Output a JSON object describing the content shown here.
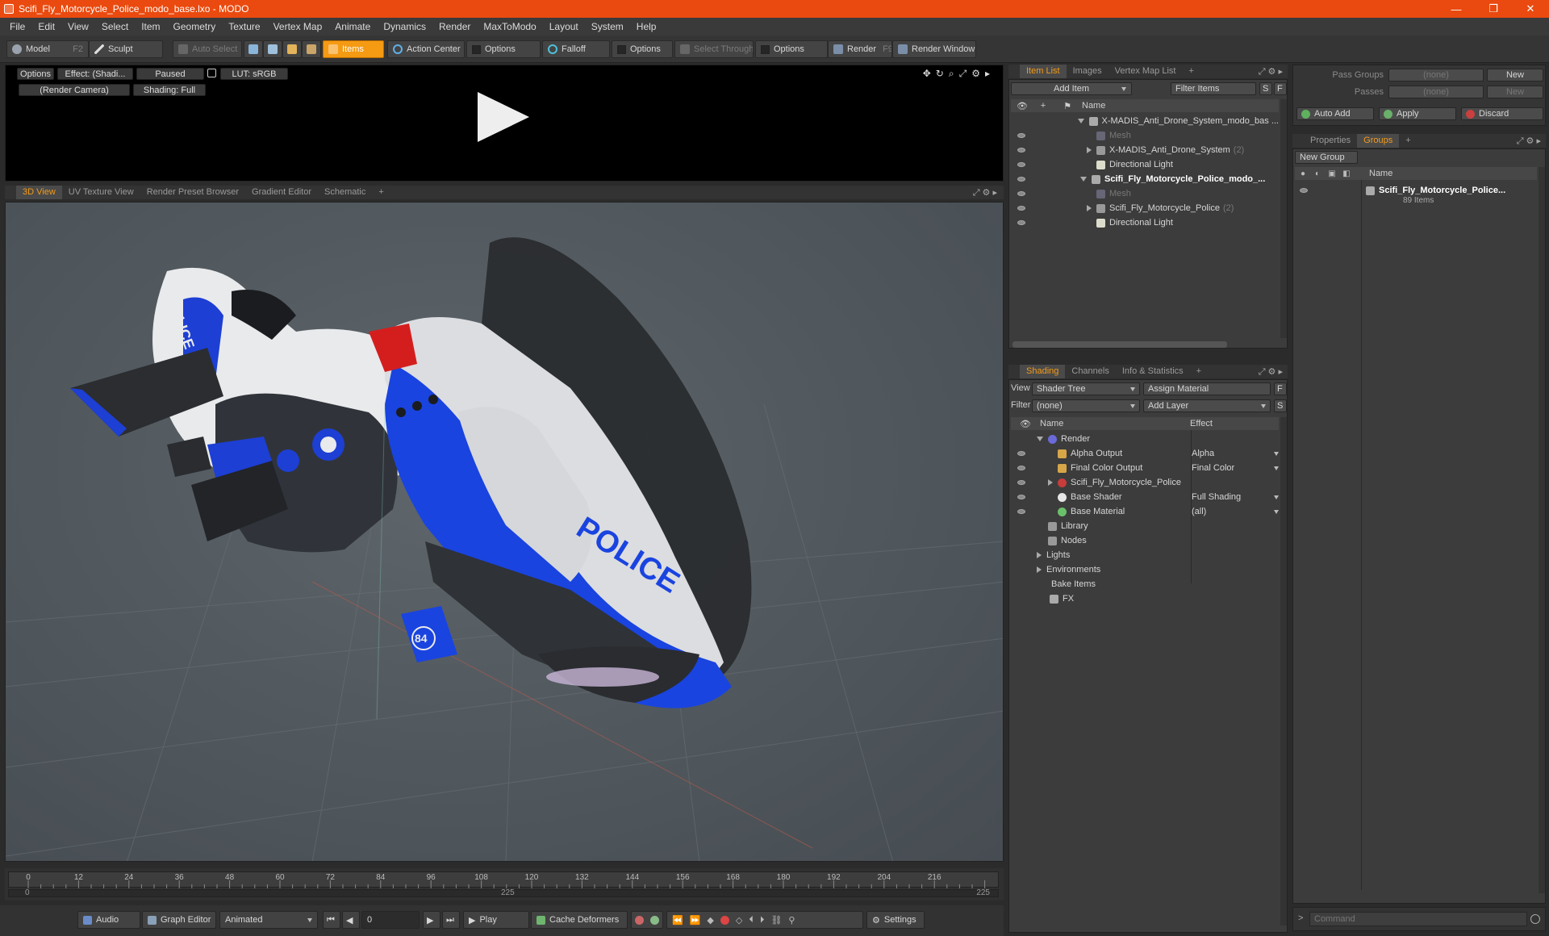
{
  "window": {
    "title": "Scifi_Fly_Motorcycle_Police_modo_base.lxo - MODO",
    "minimize": "—",
    "restore": "❐",
    "close": "✕"
  },
  "menu": [
    "File",
    "Edit",
    "View",
    "Select",
    "Item",
    "Geometry",
    "Texture",
    "Vertex Map",
    "Animate",
    "Dynamics",
    "Render",
    "MaxToModo",
    "Layout",
    "System",
    "Help"
  ],
  "toolbar": {
    "model": "Model",
    "model_key": "F2",
    "sculpt": "Sculpt",
    "auto_select": "Auto Select",
    "items": "Items",
    "action_center": "Action Center",
    "options1": "Options",
    "falloff": "Falloff",
    "options2": "Options",
    "select_through": "Select Through",
    "options3": "Options",
    "render": "Render",
    "render_key": "F9",
    "render_window": "Render Window"
  },
  "preview": {
    "options": "Options",
    "effect": "Effect: (Shadi...",
    "paused": "Paused",
    "lut": "LUT: sRGB",
    "camera": "(Render Camera)",
    "shading": "Shading: Full"
  },
  "viewport_tabs": [
    "3D View",
    "UV Texture View",
    "Render Preset Browser",
    "Gradient Editor",
    "Schematic"
  ],
  "timeline": {
    "ticks": [
      "0",
      "12",
      "24",
      "36",
      "48",
      "60",
      "72",
      "84",
      "96",
      "108",
      "120",
      "132",
      "144",
      "156",
      "168",
      "180",
      "192",
      "204",
      "216"
    ],
    "start": "0",
    "mid": "225",
    "end": "225"
  },
  "bottom": {
    "audio": "Audio",
    "graph_editor": "Graph Editor",
    "animated": "Animated",
    "frame": "0",
    "play": "Play",
    "cache": "Cache Deformers",
    "settings": "Settings"
  },
  "itemlist": {
    "tabs": [
      "Item List",
      "Images",
      "Vertex Map List"
    ],
    "add_item": "Add Item",
    "filter_items": "Filter Items",
    "s": "S",
    "f": "F",
    "col_name": "Name",
    "rows": [
      {
        "label": "X-MADIS_Anti_Drone_System_modo_bas ...",
        "bold": false,
        "count": ""
      },
      {
        "label": "Mesh",
        "bold": false,
        "count": ""
      },
      {
        "label": "X-MADIS_Anti_Drone_System",
        "bold": false,
        "count": "(2)"
      },
      {
        "label": "Directional Light",
        "bold": false,
        "count": ""
      },
      {
        "label": "Scifi_Fly_Motorcycle_Police_modo_...",
        "bold": true,
        "count": ""
      },
      {
        "label": "Mesh",
        "bold": false,
        "count": ""
      },
      {
        "label": "Scifi_Fly_Motorcycle_Police",
        "bold": false,
        "count": "(2)"
      },
      {
        "label": "Directional Light",
        "bold": false,
        "count": ""
      }
    ]
  },
  "shading": {
    "tabs": [
      "Shading",
      "Channels",
      "Info & Statistics"
    ],
    "view_label": "View",
    "view_value": "Shader Tree",
    "assign_material": "Assign Material",
    "filter_label": "Filter",
    "filter_value": "(none)",
    "add_layer": "Add Layer",
    "f": "F",
    "s": "S",
    "col_name": "Name",
    "col_effect": "Effect",
    "rows": [
      {
        "label": "Render",
        "effect": ""
      },
      {
        "label": "Alpha Output",
        "effect": "Alpha"
      },
      {
        "label": "Final Color Output",
        "effect": "Final Color"
      },
      {
        "label": "Scifi_Fly_Motorcycle_Police",
        "effect": ""
      },
      {
        "label": "Base Shader",
        "effect": "Full Shading"
      },
      {
        "label": "Base Material",
        "effect": "(all)"
      },
      {
        "label": "Library",
        "effect": ""
      },
      {
        "label": "Nodes",
        "effect": ""
      },
      {
        "label": "Lights",
        "effect": ""
      },
      {
        "label": "Environments",
        "effect": ""
      },
      {
        "label": "Bake Items",
        "effect": ""
      },
      {
        "label": "FX",
        "effect": ""
      }
    ]
  },
  "passes": {
    "pass_groups_label": "Pass Groups",
    "pass_groups_value": "(none)",
    "new": "New",
    "passes_label": "Passes",
    "passes_value": "(none)",
    "new2": "New"
  },
  "groups_actions": {
    "auto_add": "Auto Add",
    "apply": "Apply",
    "discard": "Discard"
  },
  "groups": {
    "tabs": [
      "Properties",
      "Groups"
    ],
    "new_group": "New Group",
    "col_name": "Name",
    "item_name": "Scifi_Fly_Motorcycle_Police...",
    "item_count": "89 Items"
  },
  "command": {
    "placeholder": "Command",
    "prompt": ">"
  },
  "model_text": {
    "side": "POLICE",
    "front": "POLICE",
    "badge": "84"
  }
}
